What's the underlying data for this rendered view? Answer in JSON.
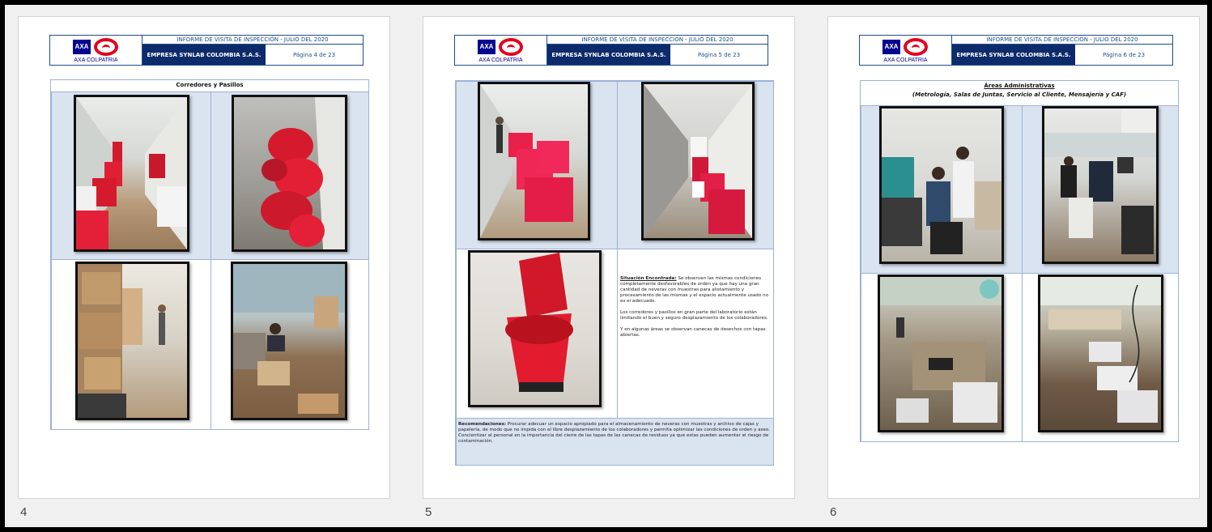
{
  "document": {
    "report_title": "INFORME DE VISITA DE INSPECCIÓN - JULIO DEL 2020",
    "company": "EMPRESA SYNLAB COLOMBIA S.A.S.",
    "logo_brand": "AXA",
    "logo_text": "AXA COLPATRIA"
  },
  "pages": [
    {
      "number": "4",
      "page_label": "Página 4 de 23",
      "section_title": "Corredores y Pasillos",
      "photos": [
        "corridor-red-bags-photo",
        "red-bags-stack-photo",
        "corridor-boxes-photo",
        "office-worker-boxes-photo"
      ]
    },
    {
      "number": "5",
      "page_label": "Página 5 de 23",
      "situation_label": "Situación Encontrada:",
      "situation_text": "Se observan las mismas condiciones completamente desfavorables de orden ya que hay una gran cantidad de neveras con muestras para alistamiento y procesamiento de las mismas y el espacio actualmente usado no es el adecuado.",
      "situation_text_2": "Los corredores y pasillos en gran parte del laboratorio están limitando el buen y seguro desplazamiento de los colaboradores.",
      "situation_text_3": "Y en algunas áreas se observan canecas de desechos con tapas abiertas.",
      "recommendation_label": "Recomendaciones:",
      "recommendation_text": "Procurar adecuar un espacio apropiado para el almacenamiento de neveras con muestras y archivo de cajas y papelería, de modo que no impida con el libre desplazamiento de los colaboradores y permita optimizar las condiciones de orden y aseo. Concientizar al personal en la importancia del cierre de las tapas de las canecas de residuos ya que estas pueden aumentar el riesgo de contaminación."
    },
    {
      "number": "6",
      "page_label": "Página 6 de 23",
      "section_title": "Áreas Administrativas",
      "section_subtitle": "(Metrología, Salas de Juntas, Servicio al Cliente, Mensajería y CAF)"
    }
  ],
  "colors": {
    "header_dark": "#0d2b6b",
    "cell_blue": "#dae3f0",
    "axa_blue": "#00008f",
    "axa_red": "#e3001b"
  }
}
